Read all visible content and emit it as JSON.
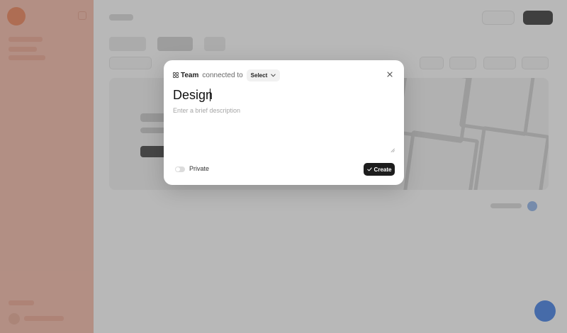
{
  "modal": {
    "team_label": "Team",
    "connected_text": "connected to",
    "select_label": "Select",
    "name_value": "Design",
    "description_placeholder": "Enter a brief description",
    "private_label": "Private",
    "private_enabled": false,
    "create_label": "Create"
  },
  "icons": {
    "team": "grid-icon",
    "select": "chevron-down-icon",
    "close": "close-icon",
    "create": "check-icon"
  },
  "colors": {
    "sidebar": "#f6b9a6",
    "brand": "#ee7f52",
    "primary_button": "#1d1d1d",
    "accent": "#3c7be6"
  }
}
